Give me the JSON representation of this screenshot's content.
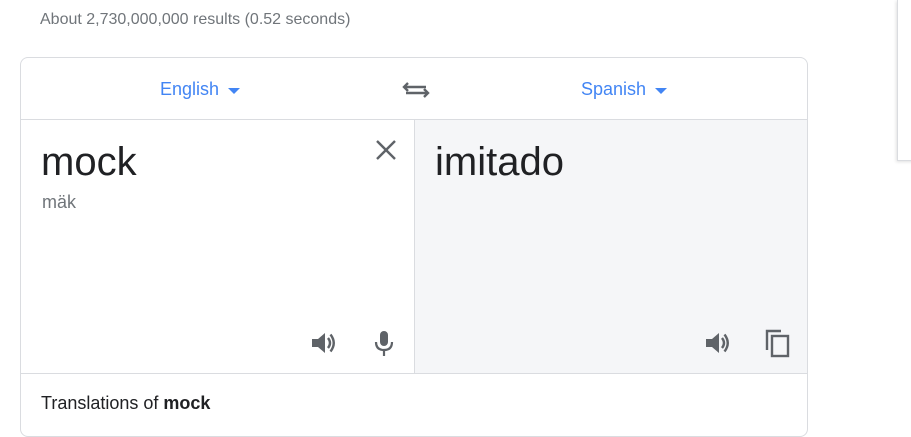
{
  "results_stats": "About 2,730,000,000 results (0.52 seconds)",
  "translate": {
    "source_language": "English",
    "target_language": "Spanish",
    "source_text": "mock",
    "phonetic": "mäk",
    "target_text": "imitado",
    "footer_prefix": "Translations of",
    "footer_word": "mock"
  },
  "icons": {
    "swap": "swap-languages-icon",
    "clear": "close-icon",
    "speaker": "speaker-icon",
    "microphone": "microphone-icon",
    "copy": "copy-icon"
  },
  "colors": {
    "accent": "#4285f4",
    "icon_gray": "#5f6368",
    "target_bg": "#f5f6f8"
  }
}
